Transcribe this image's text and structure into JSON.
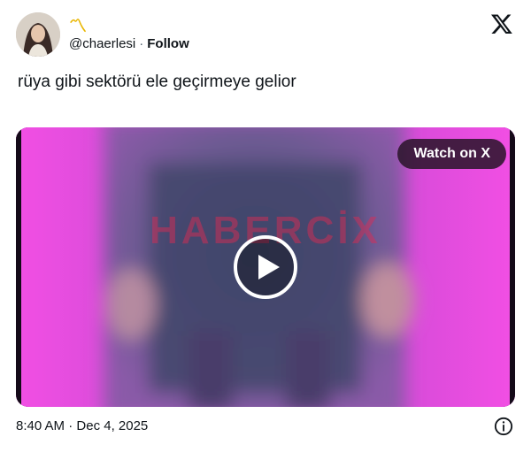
{
  "user": {
    "handle": "@chaerlesi",
    "follow_label": "Follow",
    "name_emoji": "〽"
  },
  "tweet": {
    "text": "rüya gibi sektörü ele geçirmeye gelior"
  },
  "media": {
    "watch_label": "Watch on X",
    "watermark": "HABERCİX"
  },
  "footer": {
    "time": "8:40 AM",
    "separator": "·",
    "date": "Dec 4, 2025"
  },
  "icons": {
    "logo": "x-logo-icon",
    "play": "play-icon",
    "info": "info-icon"
  },
  "colors": {
    "text": "#0f1419",
    "muted": "#536471",
    "magenta": "#f04ce0"
  }
}
